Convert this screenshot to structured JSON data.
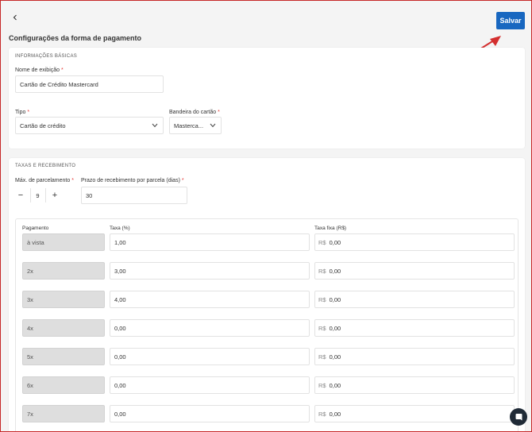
{
  "header": {
    "title": "Configurações da forma de pagamento",
    "save_label": "Salvar"
  },
  "basic_info": {
    "section_title": "INFORMAÇÕES BÁSICAS",
    "display_name_label": "Nome de exibição",
    "display_name_value": "Cartão de Crédito Mastercard",
    "type_label": "Tipo",
    "type_value": "Cartão de crédito",
    "brand_label": "Bandeira do cartão",
    "brand_value": "Mastercа..."
  },
  "fees": {
    "section_title": "TAXAS E RECEBIMENTO",
    "max_installments_label": "Máx. de parcelamento",
    "max_installments_value": "9",
    "receive_days_label": "Prazo de recebimento por parcela (dias)",
    "receive_days_value": "30",
    "columns": {
      "payment": "Pagamento",
      "rate": "Taxa (%)",
      "fixed": "Taxa fixa (R$)"
    },
    "currency_prefix": "R$",
    "rows": [
      {
        "payment": "à vista",
        "rate": "1,00",
        "fixed": "0,00"
      },
      {
        "payment": "2x",
        "rate": "3,00",
        "fixed": "0,00"
      },
      {
        "payment": "3x",
        "rate": "4,00",
        "fixed": "0,00"
      },
      {
        "payment": "4x",
        "rate": "0,00",
        "fixed": "0,00"
      },
      {
        "payment": "5x",
        "rate": "0,00",
        "fixed": "0,00"
      },
      {
        "payment": "6x",
        "rate": "0,00",
        "fixed": "0,00"
      },
      {
        "payment": "7x",
        "rate": "0,00",
        "fixed": "0,00"
      }
    ]
  },
  "icons": {
    "back": "chevron-left-icon",
    "chevron": "chevron-down-icon",
    "chat": "chat-icon"
  },
  "colors": {
    "primary": "#1867c0",
    "annotation": "#d32f2f",
    "required": "#e53935"
  }
}
